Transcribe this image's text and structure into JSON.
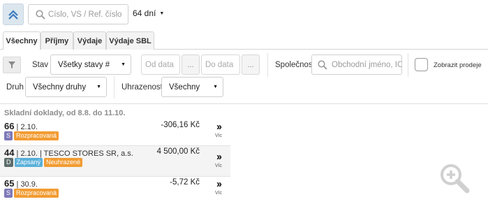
{
  "top": {
    "search_placeholder": "Číslo, VS / Ref. číslo",
    "days_value": "64 dní"
  },
  "tabs": [
    {
      "label": "Všechny",
      "active": true
    },
    {
      "label": "Příjmy",
      "active": false
    },
    {
      "label": "Výdaje",
      "active": false
    },
    {
      "label": "Výdaje SBL",
      "active": false
    }
  ],
  "filters": {
    "stav_label": "Stav",
    "stav_value": "Všetky stavy #",
    "od_placeholder": "Od data",
    "do_placeholder": "Do data",
    "picker_glyph": "...",
    "spolecnost_label": "Společnost",
    "company_placeholder": "Obchodní jméno, IČO",
    "prodeje_label": "Zobrazit prodeje",
    "druh_label": "Druh",
    "druh_value": "Všechny druhy",
    "uhrazenost_label": "Uhrazenost",
    "uhrazenost_value": "Všechny"
  },
  "list": {
    "section_title": "Skladní doklady, od 8.8. do 11.10.",
    "more_label": "Víc",
    "rows": [
      {
        "number": "66",
        "detail": " | 2.10.",
        "amount": "-306,16 Kč",
        "badges": [
          {
            "text": "S"
          },
          {
            "text": "Rozpracovaná"
          }
        ]
      },
      {
        "number": "44",
        "detail": " | 2.10. | TESCO STORES SR, a.s.",
        "amount": "4 500,00 Kč",
        "badges": [
          {
            "text": "D"
          },
          {
            "text": "Zapsaný"
          },
          {
            "text": "Neuhrazené"
          }
        ]
      },
      {
        "number": "65",
        "detail": " | 30.9.",
        "amount": "-5,72 Kč",
        "badges": [
          {
            "text": "S"
          },
          {
            "text": "Rozpracovaná"
          }
        ]
      }
    ]
  },
  "colors": {
    "accent_blue": "#5ab0da",
    "status_orange": "#f29c33",
    "type_s": "#7e78b8",
    "type_d": "#5c6d6b"
  },
  "icons": {
    "collapse": "double-chevron-up-icon",
    "search": "search-icon",
    "filter": "filter-icon",
    "zoom": "zoom-in-icon",
    "more": "double-chevron-right-icon"
  }
}
